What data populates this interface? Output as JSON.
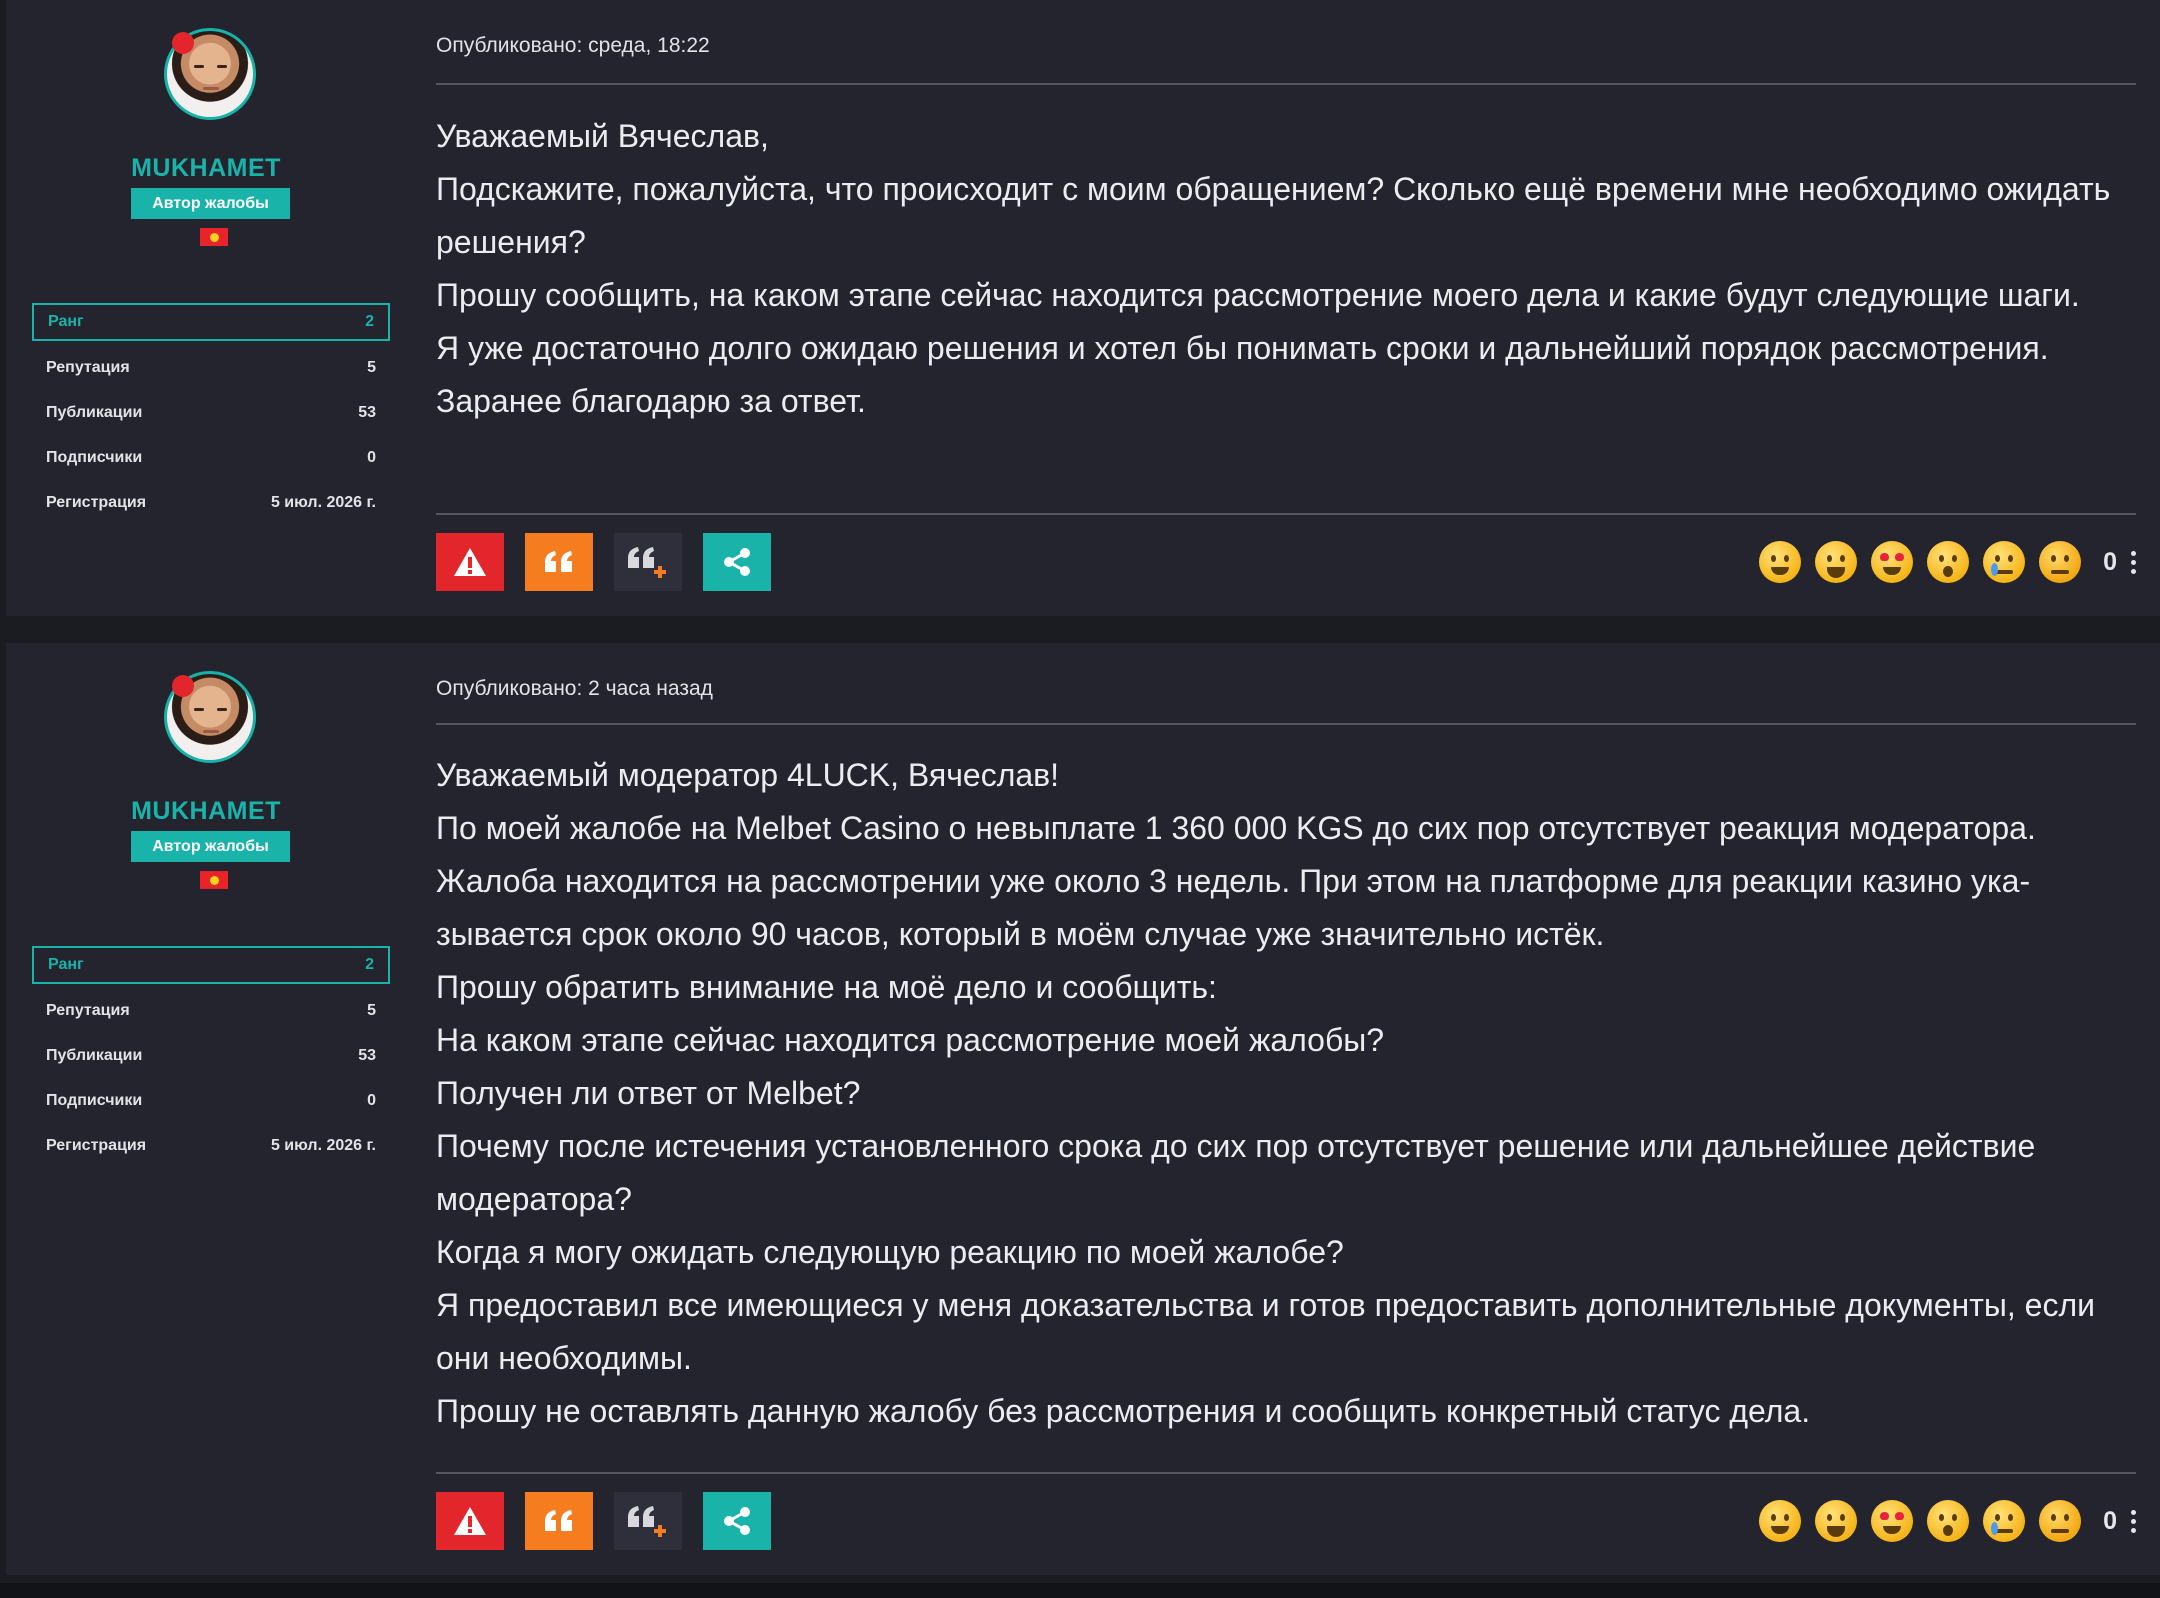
{
  "posts": [
    {
      "author": {
        "name": "MUKHAMET",
        "role": "Автор жалобы",
        "stats": [
          {
            "label": "Ранг",
            "value": "2"
          },
          {
            "label": "Репутация",
            "value": "5"
          },
          {
            "label": "Публикации",
            "value": "53"
          },
          {
            "label": "Подписчики",
            "value": "0"
          },
          {
            "label": "Регистрация",
            "value": "5 июл. 2026 г."
          }
        ]
      },
      "date": "Опубликовано: среда, 18:22",
      "lines": [
        "Уважаемый Вячеслав,",
        "Подскажите, пожалуйста, что происходит с моим обращением? Сколько ещё времени мне необходимо ожидать решения?",
        "Прошу сообщить, на каком этапе сейчас находится рассмотрение моего дела и какие будут следующие шаги.",
        "Я уже достаточно долго ожидаю решения и хотел бы понимать сроки и дальнейший порядок рассмотрения.",
        "Заранее благодарю за ответ."
      ],
      "reaction_count": "0"
    },
    {
      "author": {
        "name": "MUKHAMET",
        "role": "Автор жалобы",
        "stats": [
          {
            "label": "Ранг",
            "value": "2"
          },
          {
            "label": "Репутация",
            "value": "5"
          },
          {
            "label": "Публикации",
            "value": "53"
          },
          {
            "label": "Подписчики",
            "value": "0"
          },
          {
            "label": "Регистрация",
            "value": "5 июл. 2026 г."
          }
        ]
      },
      "date": "Опубликовано: 2 часа назад",
      "lines": [
        "Уважаемый модератор 4LUCK, Вячеслав!",
        "По моей жалобе на Melbet Casino о невыплате 1 360 000 KGS до сих пор отсутствует реакция модератора.",
        "Жалоба находится на рассмотрении уже около 3 недель. При этом на платформе для реакции казино ука­зывается срок около 90 часов, который в моём случае уже значительно истёк.",
        "Прошу обратить внимание на моё дело и сообщить:",
        "На каком этапе сейчас находится рассмотрение моей жалобы?",
        "Получен ли ответ от Melbet?",
        "Почему после истечения установленного срока до сих пор отсутствует решение или дальнейшее действие модератора?",
        "Когда я могу ожидать следующую реакцию по моей жалобе?",
        "Я предоставил все имеющиеся у меня доказательства и готов предоставить дополнительные документы, если они необходимы.",
        "Прошу не оставлять данную жалобу без рассмотрения и сообщить конкретный статус дела."
      ],
      "reaction_count": "0"
    }
  ],
  "actions": {
    "report_icon": "warning-icon",
    "quote_icon": "quote-icon",
    "multiquote_icon": "multiquote-add-icon",
    "share_icon": "share-icon"
  },
  "reactions": [
    "slightly-smiling-icon",
    "grinning-squinting-icon",
    "heart-eyes-icon",
    "astonished-icon",
    "crying-icon",
    "angry-icon"
  ],
  "colors": {
    "accent": "#19b3a9",
    "report": "#e2262b",
    "quote": "#f57d1f",
    "background": "#23242e"
  }
}
